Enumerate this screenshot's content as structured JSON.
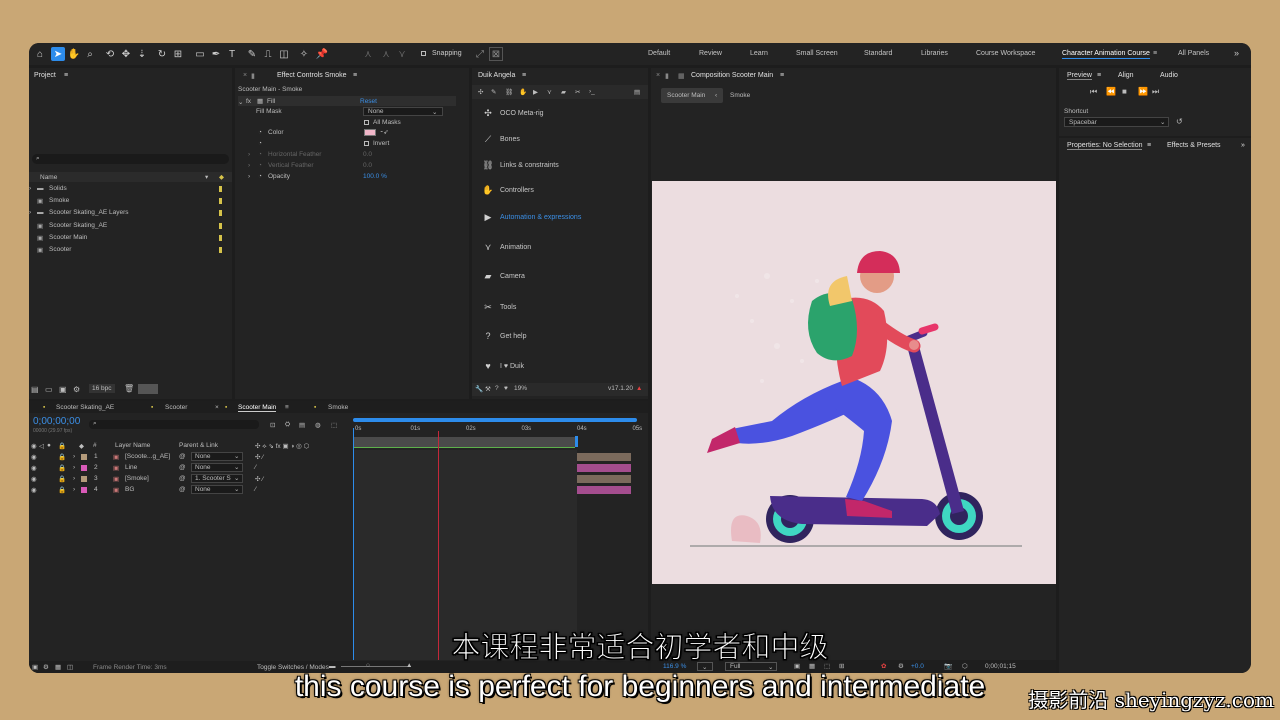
{
  "toolbar": {
    "snapping_label": "Snapping",
    "workspaces": [
      "Default",
      "Review",
      "Learn",
      "Small Screen",
      "Standard",
      "Libraries",
      "Course Workspace",
      "Character Animation Course",
      "All Panels"
    ],
    "active_workspace": "Character Animation Course"
  },
  "project": {
    "title": "Project",
    "search_placeholder": "",
    "column_name": "Name",
    "items": [
      {
        "name": "Solids",
        "color": "#d6c34a"
      },
      {
        "name": "Smoke",
        "color": "#d6c34a"
      },
      {
        "name": "Scooter Skating_AE Layers",
        "color": "#d6c34a"
      },
      {
        "name": "Scooter Skating_AE",
        "color": "#d6c34a"
      },
      {
        "name": "Scooter Main",
        "color": "#d6c34a"
      },
      {
        "name": "Scooter",
        "color": "#d6c34a"
      }
    ],
    "bpc": "16 bpc"
  },
  "effect_controls": {
    "title": "Effect Controls Smoke",
    "subtitle": "Scooter Main - Smoke",
    "fx_name": "Fill",
    "reset": "Reset",
    "fill_mask_label": "Fill Mask",
    "fill_mask_value": "None",
    "all_masks": "All Masks",
    "color_label": "Color",
    "invert": "Invert",
    "horizontal_feather": "Horizontal Feather",
    "horizontal_feather_value": "0.0",
    "vertical_feather": "Vertical Feather",
    "vertical_feather_value": "0.0",
    "opacity": "Opacity",
    "opacity_value": "100.0 %"
  },
  "duik": {
    "title": "Duik Angela",
    "items": [
      {
        "icon": "oco-icon",
        "label": "OCO Meta-rig"
      },
      {
        "icon": "bone-icon",
        "label": "Bones"
      },
      {
        "icon": "link-icon",
        "label": "Links & constraints"
      },
      {
        "icon": "hand-icon",
        "label": "Controllers"
      },
      {
        "icon": "play-icon",
        "label": "Automation & expressions",
        "active": true
      },
      {
        "icon": "animation-icon",
        "label": "Animation"
      },
      {
        "icon": "camera-icon",
        "label": "Camera"
      },
      {
        "icon": "wrench-icon",
        "label": "Tools"
      },
      {
        "icon": "help-icon",
        "label": "Get help"
      },
      {
        "icon": "heart-icon",
        "label": "I ♥ Duik"
      }
    ],
    "percent": "19%",
    "version": "v17.1.20"
  },
  "composition": {
    "title": "Composition Scooter Main",
    "crumb_active": "Scooter Main",
    "crumb_next": "Smoke",
    "zoom": "116.9 %",
    "resolution": "Full",
    "green_value": "+0.0",
    "timecode": "0;00;01;15"
  },
  "preview": {
    "tabs": [
      "Preview",
      "Align",
      "Audio"
    ],
    "shortcut_label": "Shortcut",
    "shortcut_value": "Spacebar"
  },
  "properties": {
    "title": "Properties: No Selection",
    "effects_tab": "Effects & Presets"
  },
  "timeline": {
    "tabs": [
      "Scooter Skating_AE",
      "Scooter",
      "Scooter Main",
      "Smoke"
    ],
    "active_tab": "Scooter Main",
    "timecode": "0;00;00;00",
    "timecode_sub": "00000 (29.97 fps)",
    "col_layer_name": "Layer Name",
    "col_parent": "Parent & Link",
    "ruler": [
      "0s",
      "01s",
      "02s",
      "03s",
      "04s",
      "05s"
    ],
    "layers": [
      {
        "num": "1",
        "name": "[Scoote...g_AE]",
        "parent": "None",
        "color": "#b39a7a",
        "bar": "#7b6a5c"
      },
      {
        "num": "2",
        "name": "Line",
        "parent": "None",
        "color": "#d95ab8",
        "bar": "#a44d8e"
      },
      {
        "num": "3",
        "name": "[Smoke]",
        "parent": "1. Scooter S",
        "color": "#b39a7a",
        "bar": "#7b6a5c"
      },
      {
        "num": "4",
        "name": "BG",
        "parent": "None",
        "color": "#d95ab8",
        "bar": "#a44d8e"
      }
    ],
    "frame_render": "Frame Render Time: 3ms",
    "toggle": "Toggle Switches / Modes"
  },
  "subtitles": {
    "cn": "本课程非常适合初学者和中级",
    "en": "this course is perfect for beginners and intermediate"
  },
  "watermark": "摄影前沿 sheyingzyz.com",
  "colors": {
    "accent": "#2d8ceb",
    "canvas_bg": "#ecdde0",
    "playhead": "#c4283a",
    "fill_swatch": "#f0b6c8"
  }
}
